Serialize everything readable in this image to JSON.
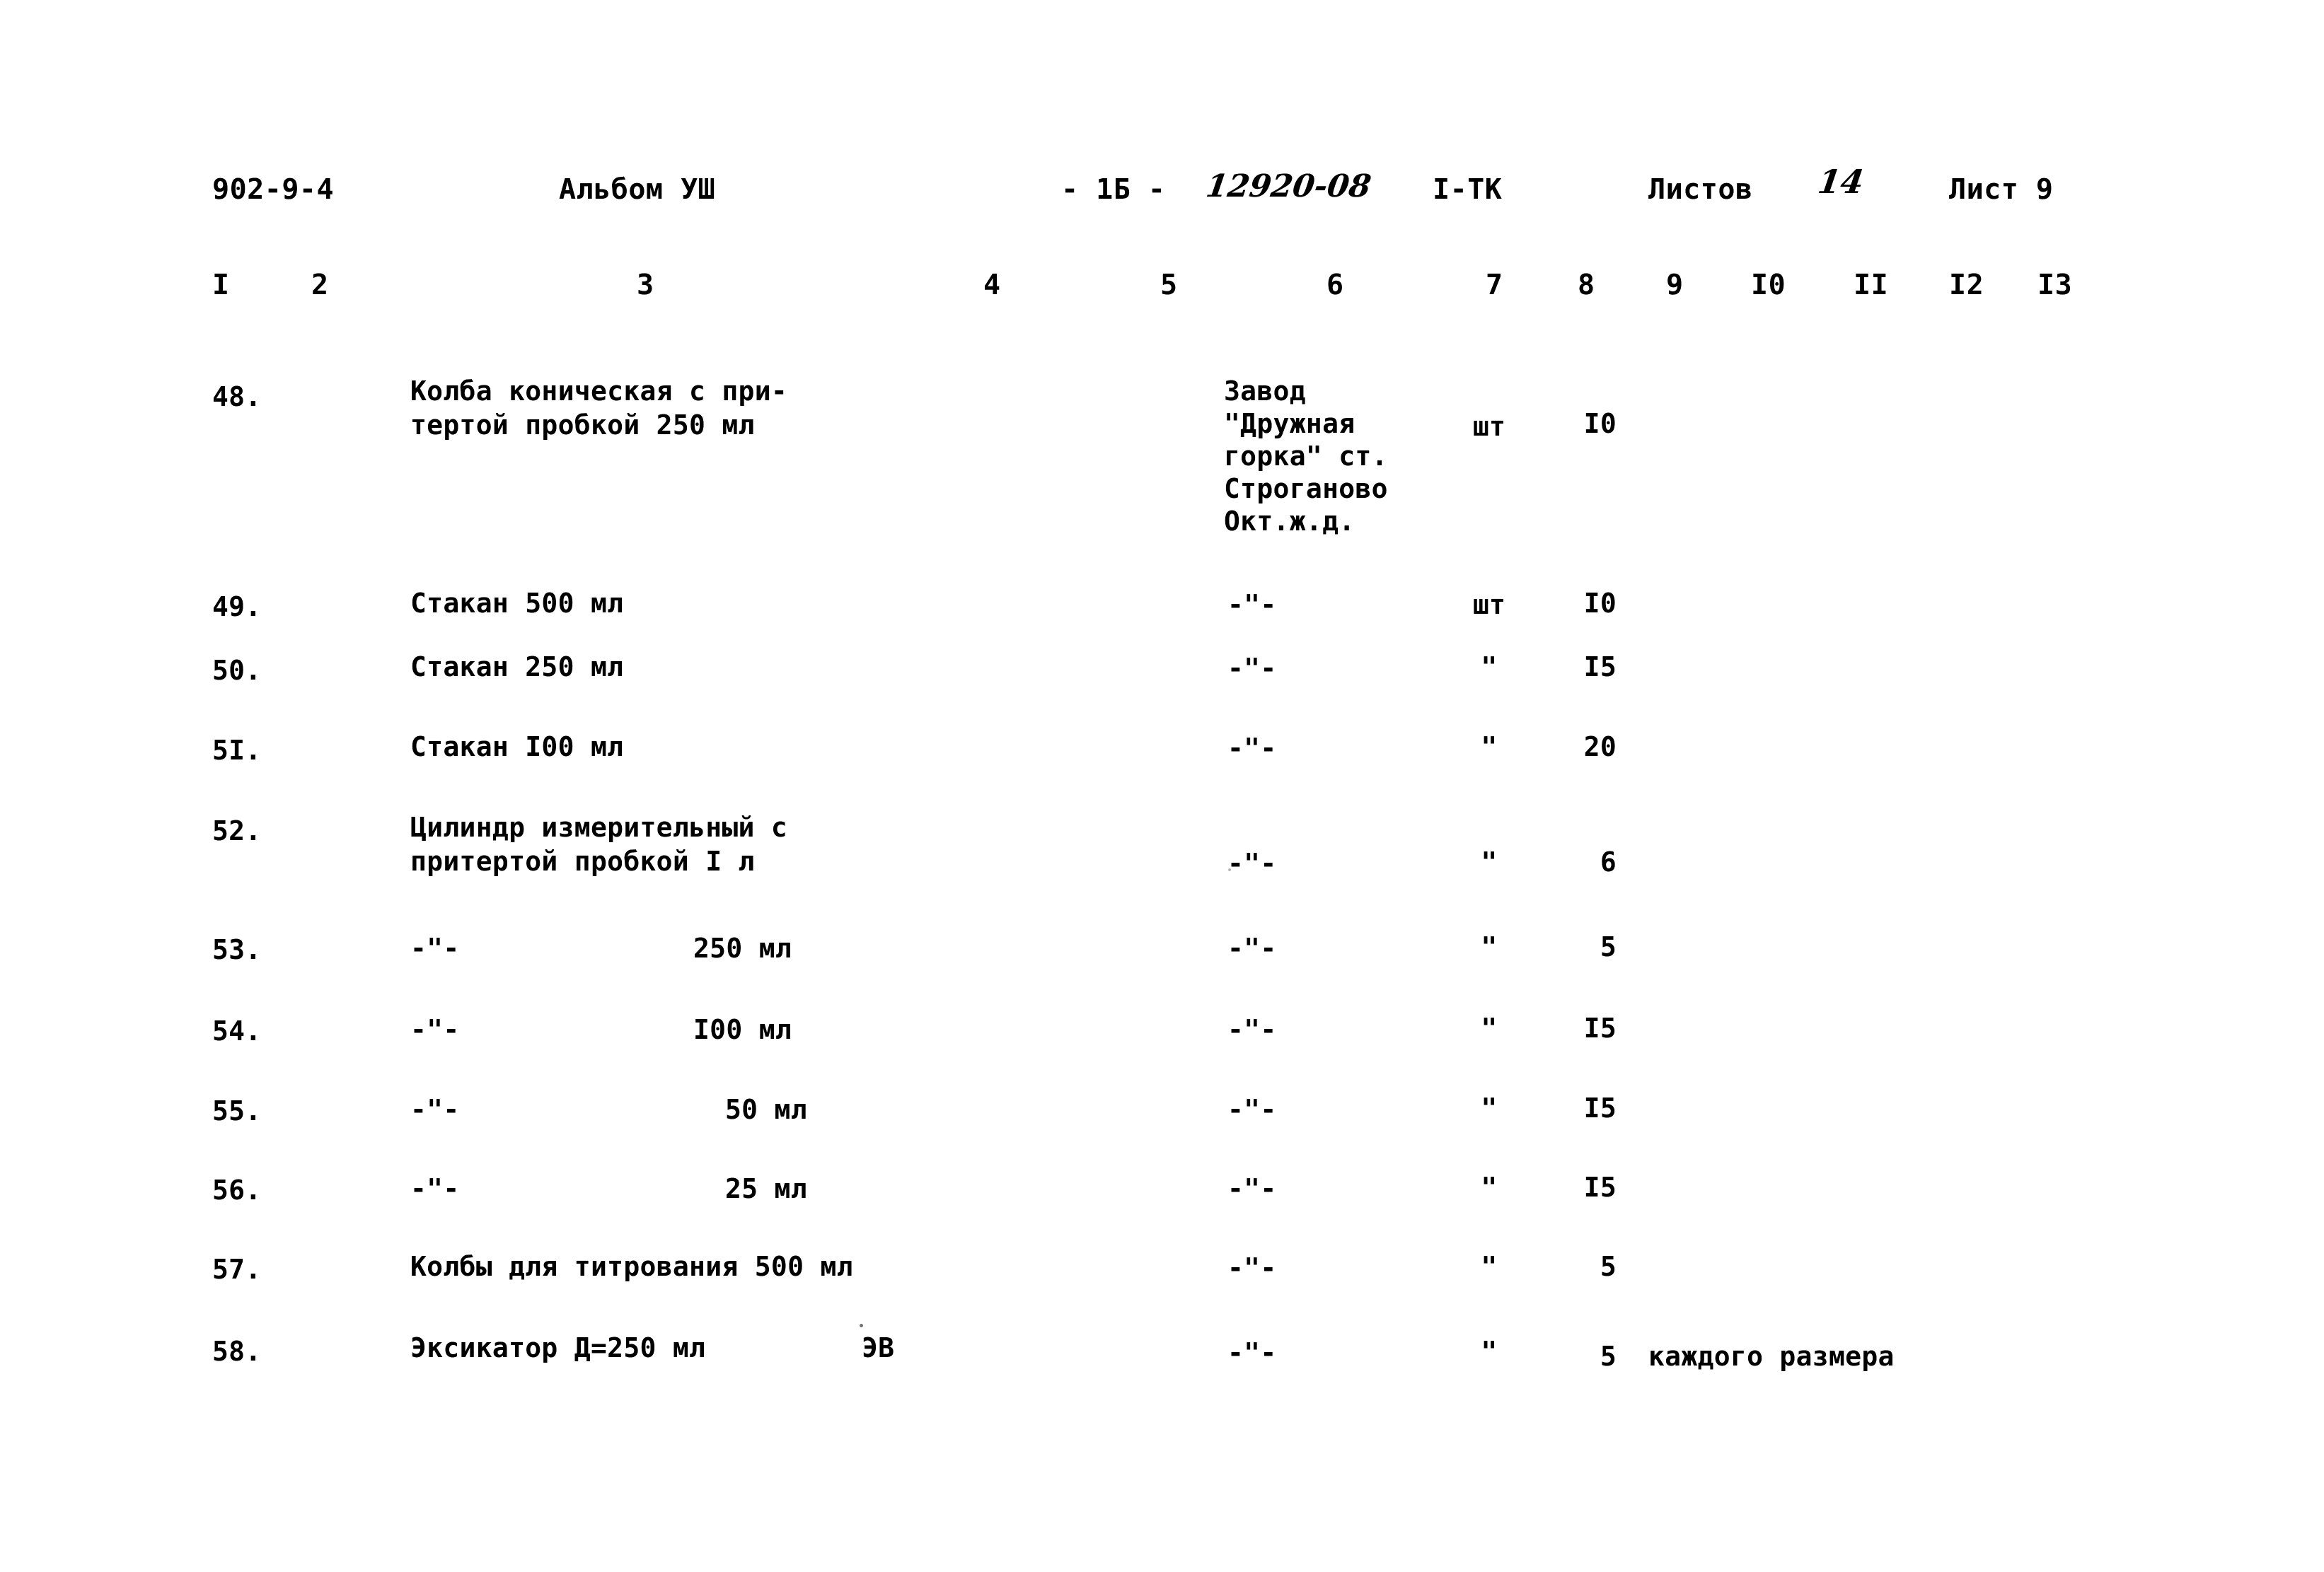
{
  "document": {
    "series_code": "902-9-4",
    "album": "Альбом УШ",
    "page_mark": "- 1Б -",
    "doc_number_handwritten": "12920-08",
    "stage": "I-ТК",
    "sheets_total_label": "Листов",
    "sheets_total_value": "14",
    "sheet_label": "Лист 9"
  },
  "column_numbers": [
    "I",
    "2",
    "3",
    "4",
    "5",
    "6",
    "7",
    "8",
    "9",
    "I0",
    "II",
    "I2",
    "I3"
  ],
  "table": {
    "rows": [
      {
        "num": "48.",
        "name_line1": "Колба коническая с при-",
        "name_line2": "тертой пробкой 250 мл",
        "maker_lines": [
          "Завод",
          "\"Дружная",
          "горка\" ст.",
          "Строганово",
          "Окт.ж.д."
        ],
        "unit": "шт",
        "qty": "I0",
        "note": ""
      },
      {
        "num": "49.",
        "name_line1": "Стакан 500 мл",
        "name_line2": "",
        "maker_ditto": "-\"-",
        "unit": "шт",
        "qty": "I0",
        "note": ""
      },
      {
        "num": "50.",
        "name_line1": "Стакан 250 мл",
        "name_line2": "",
        "maker_ditto": "-\"-",
        "unit": "\"",
        "qty": "I5",
        "note": ""
      },
      {
        "num": "5I.",
        "name_line1": "Стакан I00 мл",
        "name_line2": "",
        "maker_ditto": "-\"-",
        "unit": "\"",
        "qty": "20",
        "note": ""
      },
      {
        "num": "52.",
        "name_line1": "Цилиндр измерительный с",
        "name_line2": "притертой пробкой I л",
        "maker_ditto": "-\"-",
        "unit": "\"",
        "qty": "6",
        "note": ""
      },
      {
        "num": "53.",
        "name_ditto": "-\"-",
        "name_size": "250 мл",
        "maker_ditto": "-\"-",
        "unit": "\"",
        "qty": "5",
        "note": ""
      },
      {
        "num": "54.",
        "name_ditto": "-\"-",
        "name_size": "I00 мл",
        "maker_ditto": "-\"-",
        "unit": "\"",
        "qty": "I5",
        "note": ""
      },
      {
        "num": "55.",
        "name_ditto": "-\"-",
        "name_size": "50 мл",
        "maker_ditto": "-\"-",
        "unit": "\"",
        "qty": "I5",
        "note": ""
      },
      {
        "num": "56.",
        "name_ditto": "-\"-",
        "name_size": "25 мл",
        "maker_ditto": "-\"-",
        "unit": "\"",
        "qty": "I5",
        "note": ""
      },
      {
        "num": "57.",
        "name_line1": "Колбы для титрования 500 мл",
        "name_line2": "",
        "maker_ditto": "-\"-",
        "unit": "\"",
        "qty": "5",
        "note": ""
      },
      {
        "num": "58.",
        "name_line1": "Эксикатор Д=250 мл",
        "name_mark": "ЭВ",
        "maker_ditto": "-\"-",
        "unit": "\"",
        "qty": "5",
        "note": "каждого размера"
      }
    ]
  }
}
